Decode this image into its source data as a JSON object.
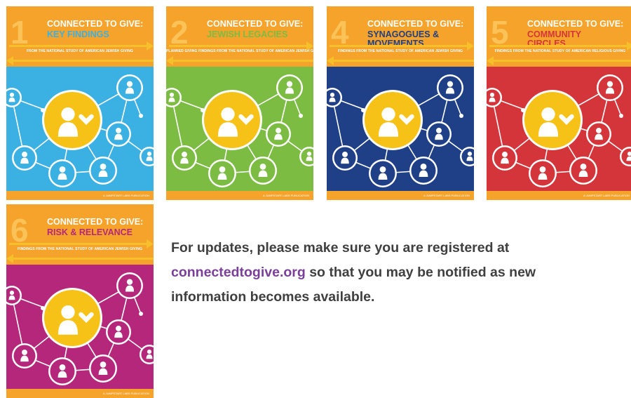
{
  "covers": [
    {
      "number": "1",
      "title_line1": "CONNECTED TO GIVE:",
      "title_line2": "KEY FINDINGS",
      "subtitle": "FROM THE NATIONAL STUDY OF AMERICAN JEWISH GIVING",
      "footer": "A JUMPSTART LABS PUBLICATION",
      "bg_color": "#3ab0e3",
      "title2_color": "#3ab0e3"
    },
    {
      "number": "2",
      "title_line1": "CONNECTED TO GIVE:",
      "title_line2": "JEWISH LEGACIES",
      "subtitle": "PLANNED GIVING FINDINGS FROM THE NATIONAL STUDY OF AMERICAN JEWISH GIVING",
      "footer": "A JUMPSTART LABS PUBLICATION",
      "bg_color": "#7cbc43",
      "title2_color": "#7cbc43"
    },
    {
      "number": "4",
      "title_line1": "CONNECTED TO GIVE:",
      "title_line2": "SYNAGOGUES & MOVEMENTS",
      "subtitle": "FINDINGS FROM THE NATIONAL STUDY OF AMERICAN JEWISH GIVING",
      "footer": "A JUMPSTART LABS PUBLICATION",
      "bg_color": "#1f3f86",
      "title2_color": "#1f3f86"
    },
    {
      "number": "5",
      "title_line1": "CONNECTED TO GIVE:",
      "title_line2": "COMMUNITY CIRCLES",
      "subtitle": "FINDINGS FROM THE NATIONAL STUDY OF AMERICAN RELIGIOUS GIVING",
      "footer": "A JUMPSTART LABS PUBLICATION",
      "bg_color": "#d4353a",
      "title2_color": "#d4353a"
    },
    {
      "number": "6",
      "title_line1": "CONNECTED TO GIVE:",
      "title_line2": "RISK & RELEVANCE",
      "subtitle": "FINDINGS FROM THE NATIONAL STUDY OF AMERICAN JEWISH GIVING",
      "footer": "A JUMPSTART LABS PUBLICATION",
      "bg_color": "#b5277a",
      "title2_color": "#b5277a"
    }
  ],
  "message": {
    "line1": "For updates, please make sure you are registered at",
    "link_text": "connectedtogive.org",
    "line2_rest": " so that you may be notified as new",
    "line3": "information becomes available."
  },
  "colors": {
    "header": "#f5a32b",
    "number": "#fbc257",
    "arrow": "#f5c02a",
    "hub": "#f7c218",
    "text": "#3f3f3f",
    "link": "#7a3f98"
  }
}
